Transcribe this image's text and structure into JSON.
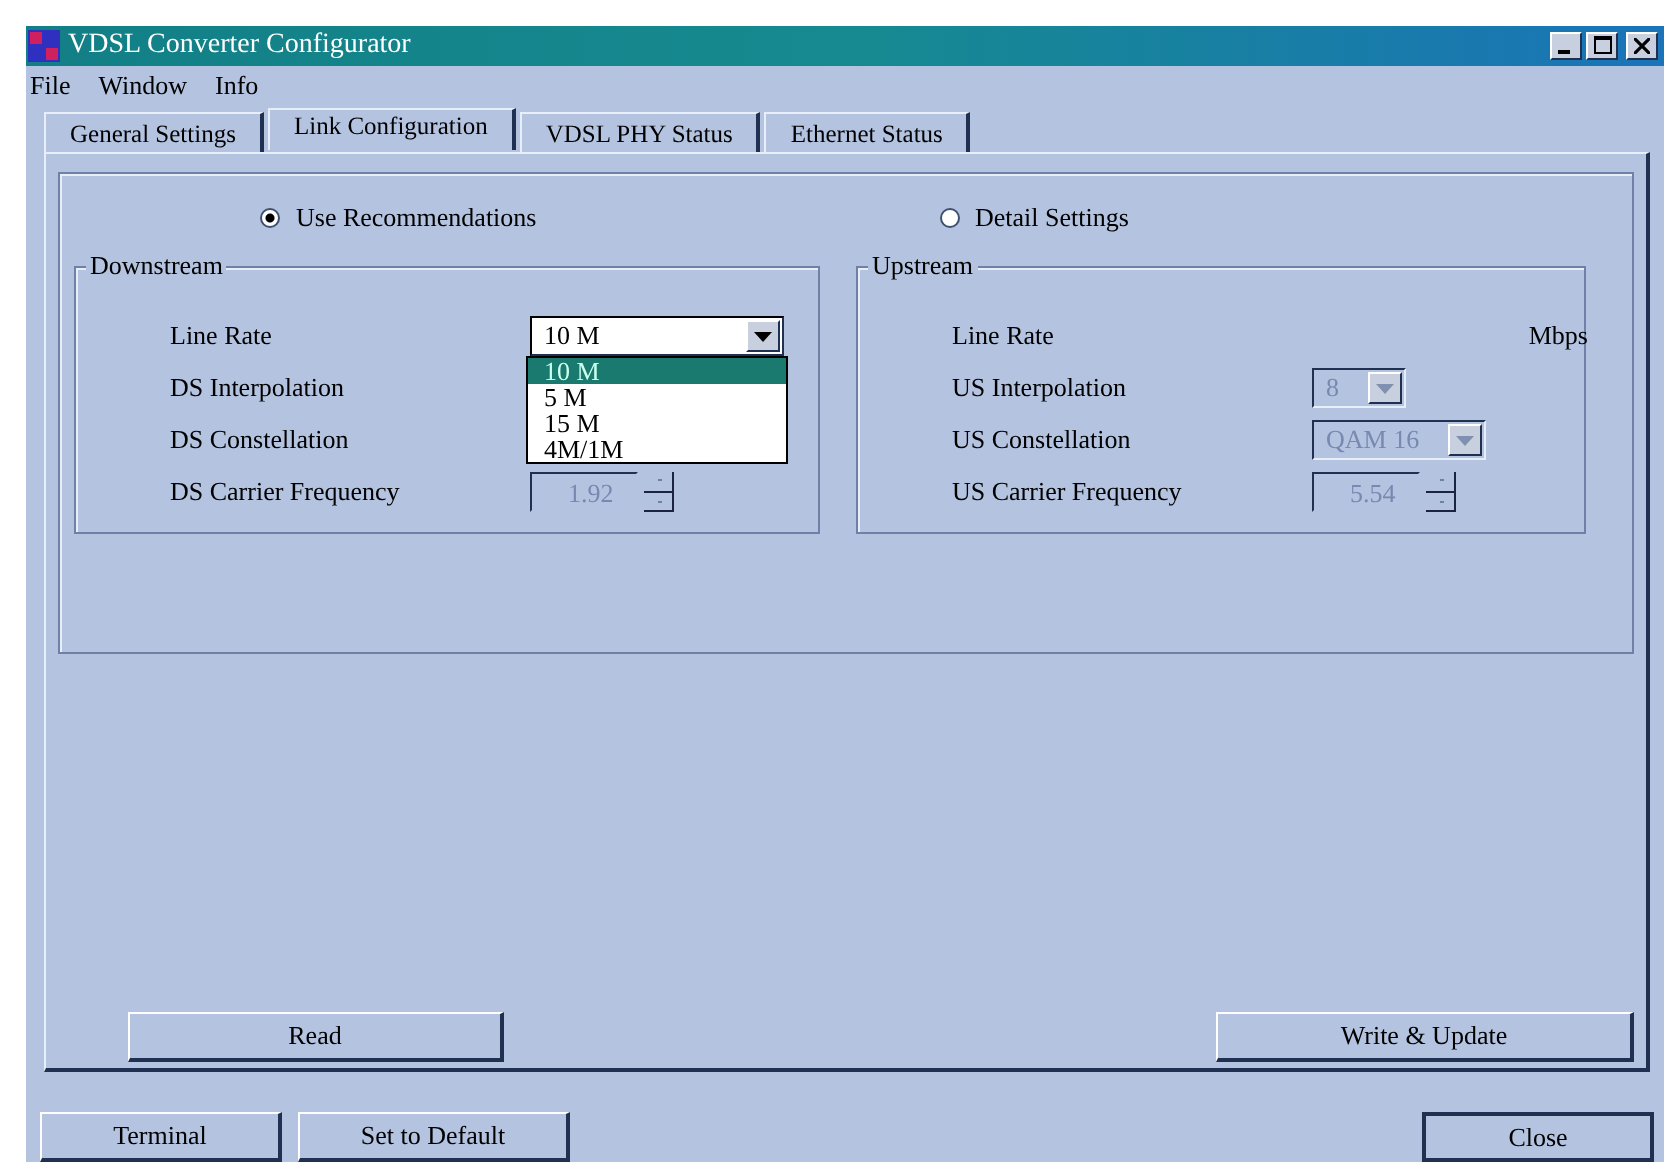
{
  "window": {
    "title": "VDSL Converter Configurator"
  },
  "menu": [
    {
      "label": "File"
    },
    {
      "label": "Window"
    },
    {
      "label": "Info"
    }
  ],
  "tabs": [
    {
      "label": "General Settings",
      "selected": false
    },
    {
      "label": "Link Configuration",
      "selected": true
    },
    {
      "label": "VDSL PHY Status",
      "selected": false
    },
    {
      "label": "Ethernet Status",
      "selected": false
    }
  ],
  "modes": [
    {
      "label": "Use Recommendations",
      "selected": true
    },
    {
      "label": "Detail Settings",
      "selected": false
    }
  ],
  "downstream": {
    "title": "Downstream",
    "rows": [
      {
        "label": "Line Rate",
        "kind": "combo",
        "value": "10 M",
        "disabled": false,
        "expanded": true,
        "options": [
          {
            "label": "10 M",
            "selected": true
          },
          {
            "label": "5 M",
            "selected": false
          },
          {
            "label": "15 M",
            "selected": false
          },
          {
            "label": "4M/1M",
            "selected": false
          }
        ]
      },
      {
        "label": "DS Interpolation",
        "kind": "none"
      },
      {
        "label": "DS Constellation",
        "kind": "none"
      },
      {
        "label": "DS Carrier Frequency",
        "kind": "spin",
        "value": "1.92",
        "disabled": true
      }
    ]
  },
  "upstream": {
    "title": "Upstream",
    "rows": [
      {
        "label": "Line Rate",
        "kind": "unit",
        "unit": "Mbps"
      },
      {
        "label": "US Interpolation",
        "kind": "combo",
        "value": "8",
        "disabled": true
      },
      {
        "label": "US Constellation",
        "kind": "combo",
        "value": "QAM 16",
        "disabled": true
      },
      {
        "label": "US Carrier Frequency",
        "kind": "spin",
        "value": "5.54",
        "disabled": true
      }
    ]
  },
  "actions": [
    {
      "label": "Read"
    },
    {
      "label": "Write & Update"
    }
  ],
  "footer": [
    {
      "label": "Terminal",
      "default": false
    },
    {
      "label": "Set to Default",
      "default": false
    },
    {
      "label": "Close",
      "default": true
    }
  ]
}
